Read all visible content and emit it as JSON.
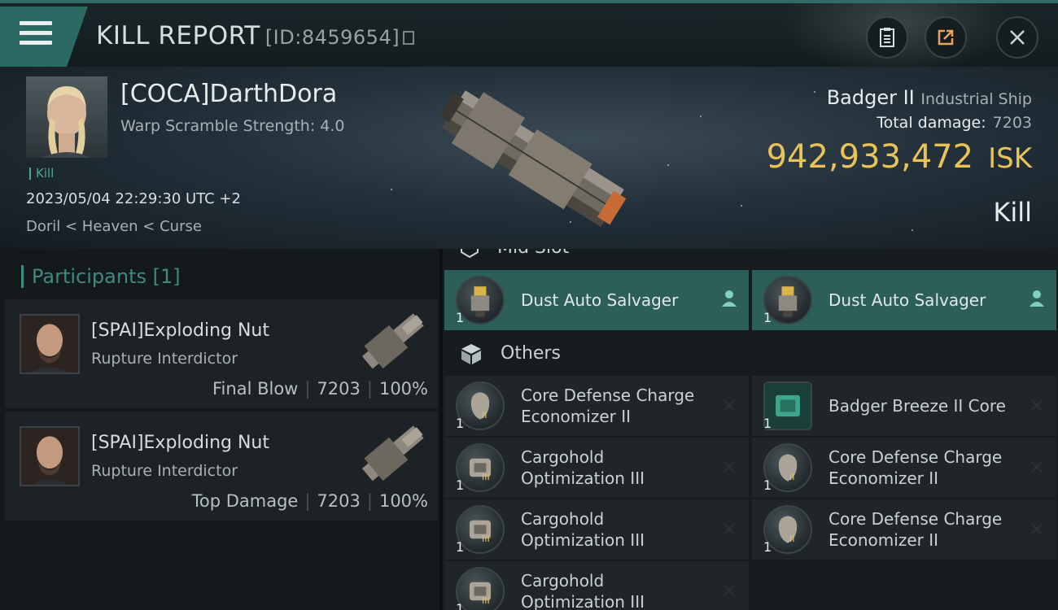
{
  "header": {
    "title": "KILL REPORT",
    "kill_id": "[ID:8459654]",
    "icons": [
      "menu-icon",
      "copy-icon",
      "clipboard-icon",
      "share-icon",
      "close-icon"
    ]
  },
  "victim": {
    "name": "[COCA]DarthDora",
    "warp_scramble": "Warp Scramble Strength: 4.0",
    "kill_tag": "Kill",
    "datetime": "2023/05/04 22:29:30 UTC +2",
    "location": "Doril < Heaven < Curse"
  },
  "ship": {
    "name": "Badger II",
    "class": "Industrial Ship",
    "total_damage_label": "Total damage:",
    "total_damage": "7203",
    "value": "942,933,472",
    "value_unit": "ISK",
    "result": "Kill"
  },
  "participants": {
    "label": "Participants",
    "count": "[1]",
    "items": [
      {
        "name": "[SPAI]Exploding Nut",
        "ship": "Rupture Interdictor",
        "role": "Final Blow",
        "damage": "7203",
        "percent": "100%"
      },
      {
        "name": "[SPAI]Exploding Nut",
        "ship": "Rupture Interdictor",
        "role": "Top Damage",
        "damage": "7203",
        "percent": "100%"
      }
    ]
  },
  "modules": {
    "mid_slot_label": "Mid Slot",
    "mid": [
      {
        "name": "Dust Auto Salvager",
        "qty": "1",
        "icon": "salvager-icon",
        "status": "pilot"
      },
      {
        "name": "Dust Auto Salvager",
        "qty": "1",
        "icon": "salvager-icon",
        "status": "pilot"
      }
    ],
    "others_label": "Others",
    "others": [
      {
        "name": "Core Defense Charge Economizer II",
        "qty": "1",
        "icon": "shield-rig-icon",
        "meta": "II"
      },
      {
        "name": "Badger Breeze II Core",
        "qty": "1",
        "icon": "core-chip-icon",
        "meta": ""
      },
      {
        "name": "Cargohold Optimization III",
        "qty": "1",
        "icon": "cargo-rig-icon",
        "meta": "III"
      },
      {
        "name": "Core Defense Charge Economizer II",
        "qty": "1",
        "icon": "shield-rig-icon",
        "meta": "II"
      },
      {
        "name": "Cargohold Optimization III",
        "qty": "1",
        "icon": "cargo-rig-icon",
        "meta": "III"
      },
      {
        "name": "Core Defense Charge Economizer II",
        "qty": "1",
        "icon": "shield-rig-icon",
        "meta": "II"
      },
      {
        "name": "Cargohold Optimization III",
        "qty": "1",
        "icon": "cargo-rig-icon",
        "meta": "III"
      }
    ]
  },
  "colors": {
    "accent_teal": "#2a6a63",
    "isk_gold": "#e9c35a",
    "kill_green": "#4fa889",
    "participants_teal": "#3e8a80"
  }
}
